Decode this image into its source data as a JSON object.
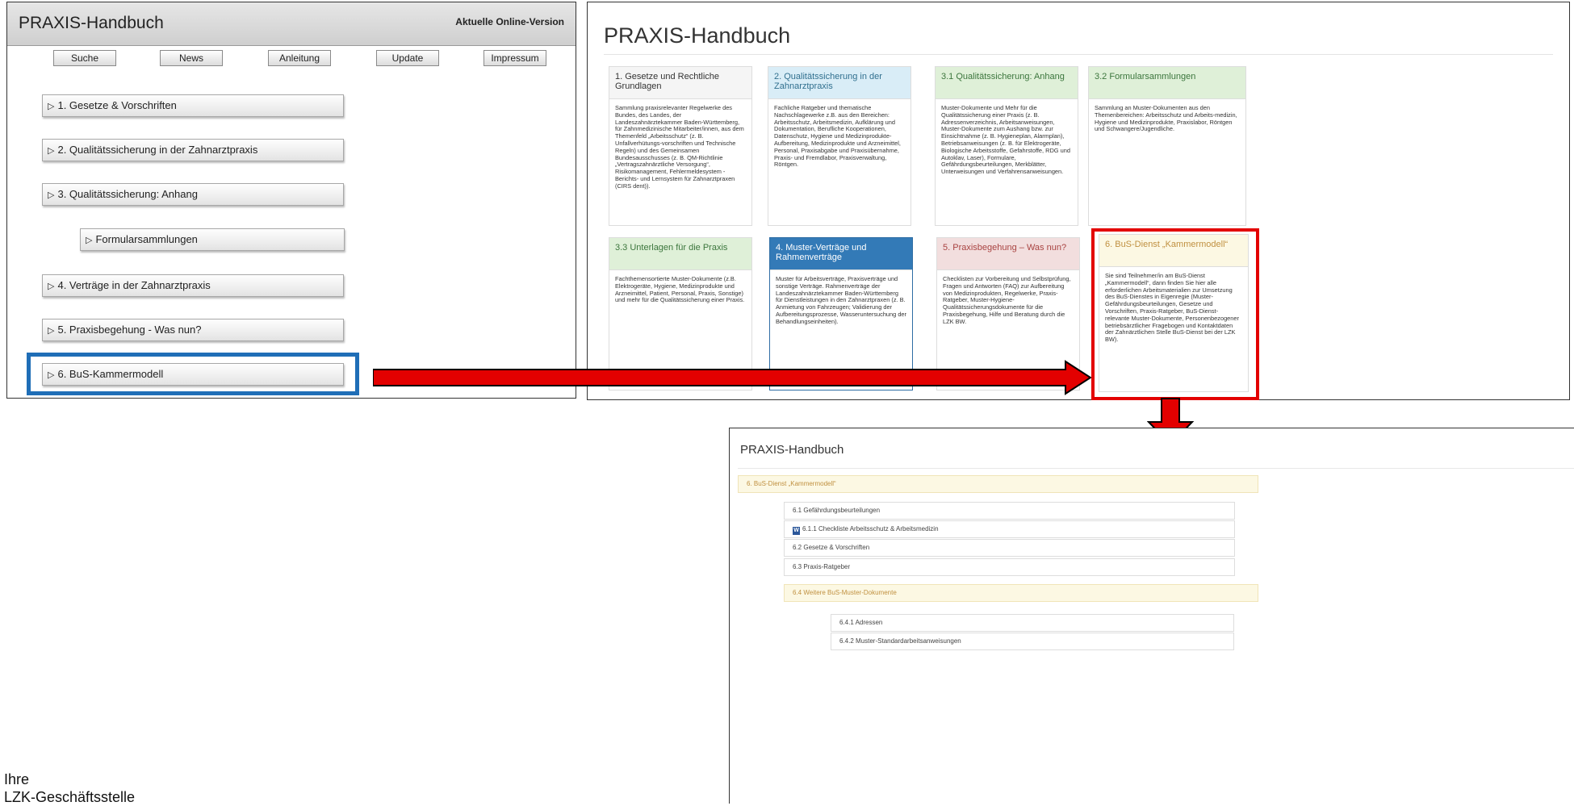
{
  "old_version": {
    "title": "PRAXIS-Handbuch",
    "version_label": "Aktuelle Online-Version",
    "nav_buttons": [
      "Suche",
      "News",
      "Anleitung",
      "Update",
      "Impressum"
    ],
    "items": [
      "1. Gesetze & Vorschriften",
      "2. Qualitätssicherung in der Zahnarztpraxis",
      "3. Qualitätssicherung: Anhang",
      "Formularsammlungen",
      "4. Verträge in der Zahnarztpraxis",
      "5. Praxisbegehung - Was nun?",
      "6. BuS-Kammermodell"
    ],
    "expand_glyph": "▷"
  },
  "new_version": {
    "title": "PRAXIS-Handbuch",
    "cards": [
      {
        "title": "1. Gesetze und Rechtliche Grundlagen",
        "body": "Sammlung praxisrelevanter Regelwerke des Bundes, des Landes, der Landeszahnärztekammer Baden-Württemberg, für Zahnmedizinische Mitarbeiter/innen, aus dem Themenfeld „Arbeitsschutz“ (z. B. Unfallverhütungs-vorschriften und Technische Regeln) und des Gemeinsamen Bundesausschusses (z. B. QM-Richtlinie „Vertragszahnärztliche Versorgung“, Risikomanagement, Fehlermeldesystem - Berichts- und Lernsystem für Zahnarztpraxen (CIRS dent))."
      },
      {
        "title": "2. Qualitätssicherung in der Zahnarztpraxis",
        "body": "Fachliche Ratgeber und thematische Nachschlagewerke z.B. aus den Bereichen: Arbeitsschutz, Arbeitsmedizin, Aufklärung und Dokumentation, Berufliche Kooperationen, Datenschutz, Hygiene und Medizinprodukte-Aufbereitung, Medizinprodukte und Arzneimittel, Personal, Praxisabgabe und Praxisübernahme, Praxis- und Fremdlabor, Praxisverwaltung, Röntgen."
      },
      {
        "title": "3.1 Qualitätssicherung: Anhang",
        "body": "Muster-Dokumente und Mehr für die Qualitätssicherung einer Praxis (z. B. Adressenverzeichnis, Arbeitsanweisungen, Muster-Dokumente zum Aushang bzw. zur Einsichtnahme (z. B. Hygieneplan, Alarmplan), Betriebsanweisungen (z. B. für Elektrogeräte, Biologische Arbeitsstoffe, Gefahrstoffe, RDG und Autoklav, Laser), Formulare, Gefährdungsbeurteilungen, Merkblätter, Unterweisungen und Verfahrensanweisungen."
      },
      {
        "title": "3.2 Formularsammlungen",
        "body": "Sammlung an Muster-Dokumenten aus den Themenbereichen: Arbeitsschutz und Arbeits-medizin, Hygiene und Medizinprodukte, Praxislabor, Röntgen und Schwangere/Jugendliche."
      },
      {
        "title": "3.3 Unterlagen für die Praxis",
        "body": "Fachthemensortierte Muster-Dokumente (z.B. Elektrogeräte, Hygiene, Medizinprodukte und Arzneimittel, Patient, Personal, Praxis, Sonstige) und mehr für die Qualitätssicherung einer Praxis."
      },
      {
        "title": "4. Muster-Verträge und Rahmenverträge",
        "body": "Muster für Arbeitsverträge, Praxisverträge und sonstige Verträge. Rahmenverträge der Landeszahnärztekammer Baden-Württemberg für Dienstleistungen in den Zahnarztpraxen (z. B. Anmietung von Fahrzeugen; Validierung der Aufbereitungsprozesse, Wasseruntersuchung der Behandlungseinheiten)."
      },
      {
        "title": "5. Praxisbegehung – Was nun?",
        "body": "Checklisten zur Vorbereitung und Selbstprüfung, Fragen und Antworten (FAQ) zur Aufbereitung von Medizinprodukten, Regelwerke, Praxis-Ratgeber, Muster-Hygiene-Qualitätssicherungsdokumente für die Praxisbegehung, Hilfe und Beratung durch die LZK BW."
      },
      {
        "title": "6. BuS-Dienst „Kammermodell“",
        "body": "Sie sind Teilnehmer/in am BuS-Dienst „Kammermodell“, dann finden Sie hier alle erforderlichen Arbeitsmaterialien zur Umsetzung des BuS-Dienstes in Eigenregie (Muster-Gefährdungsbeurteilungen, Gesetze und Vorschriften, Praxis-Ratgeber, BuS-Dienst-relevante Muster-Dokumente, Personenbezogener betriebsärztlicher Fragebogen und Kontaktdaten der Zahnärztlichen Stelle BuS-Dienst bei der LZK BW)."
      }
    ]
  },
  "detail": {
    "title": "PRAXIS-Handbuch",
    "section": "6. BuS-Dienst „Kammermodell“",
    "rows": [
      "6.1 Gefährdungsbeurteilungen",
      "6.1.1 Checkliste Arbeitsschutz & Arbeitsmedizin",
      "6.2 Gesetze & Vorschriften",
      "6.3 Praxis-Ratgeber",
      "6.4 Weitere BuS-Muster-Dokumente",
      "6.4.1 Adressen",
      "6.4.2 Muster-Standardarbeitsanweisungen"
    ],
    "word_icon": "W"
  },
  "footer": {
    "line1": "Ihre",
    "line2": "LZK-Geschäftsstelle"
  },
  "colors": {
    "highlight_blue": "#1f6eb7",
    "highlight_red": "#e30000",
    "arrow_red": "#e30000"
  }
}
